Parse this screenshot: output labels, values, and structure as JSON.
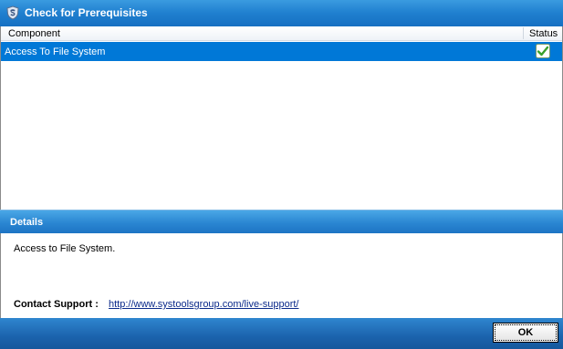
{
  "window": {
    "title": "Check for Prerequisites",
    "icon": "app-shield-icon"
  },
  "list": {
    "columns": {
      "component": "Component",
      "status": "Status"
    },
    "rows": [
      {
        "label": "Access To File System",
        "status_icon": "checkmark-icon",
        "selected": true
      }
    ]
  },
  "details": {
    "header": "Details",
    "text": "Access to File System.",
    "contact_label": "Contact Support :",
    "contact_link": "http://www.systoolsgroup.com/live-support/"
  },
  "footer": {
    "ok_label": "OK"
  },
  "colors": {
    "titlebar": "#1f7fcf",
    "selection": "#0078d7",
    "footer": "#1b63ad",
    "link": "#0b2a8a"
  }
}
